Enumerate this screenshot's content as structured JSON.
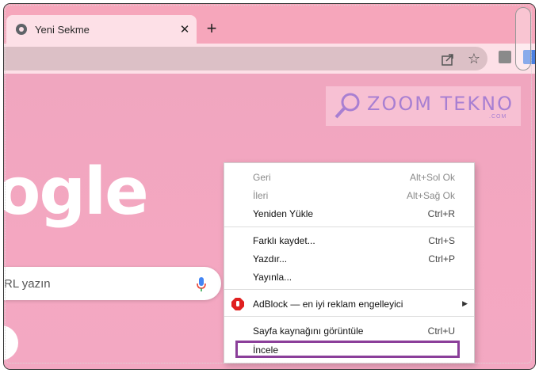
{
  "tab": {
    "title": "Yeni Sekme",
    "close": "✕"
  },
  "newtab": {
    "label": "+"
  },
  "search": {
    "placeholder": "RL yazın"
  },
  "google": {
    "fragment": "ogle"
  },
  "watermark": {
    "brand": "ZOOM TEKNO",
    "sub": ".COM"
  },
  "menu": {
    "items": [
      {
        "label": "Geri",
        "shortcut": "Alt+Sol Ok",
        "disabled": true
      },
      {
        "label": "İleri",
        "shortcut": "Alt+Sağ Ok",
        "disabled": true
      },
      {
        "label": "Yeniden Yükle",
        "shortcut": "Ctrl+R",
        "disabled": false
      },
      {
        "label": "Farklı kaydet...",
        "shortcut": "Ctrl+S",
        "disabled": false
      },
      {
        "label": "Yazdır...",
        "shortcut": "Ctrl+P",
        "disabled": false
      },
      {
        "label": "Yayınla...",
        "shortcut": "",
        "disabled": false
      },
      {
        "label": "AdBlock — en iyi reklam engelleyici",
        "shortcut": "",
        "disabled": false
      },
      {
        "label": "Sayfa kaynağını görüntüle",
        "shortcut": "Ctrl+U",
        "disabled": false
      },
      {
        "label": "İncele",
        "shortcut": "",
        "disabled": false
      }
    ],
    "submenu_arrow": "▶"
  },
  "colors": {
    "highlight": "#8b3f9a",
    "adblock": "#e02020",
    "tabstrip": "#f6a6bb",
    "page": "#f2a8c0"
  },
  "icons": [
    "chrome-favicon-icon",
    "close-icon",
    "plus-icon",
    "share-icon",
    "star-icon",
    "extension-icon",
    "translate-icon",
    "microphone-icon",
    "adblock-icon",
    "search-magnifier-icon"
  ]
}
